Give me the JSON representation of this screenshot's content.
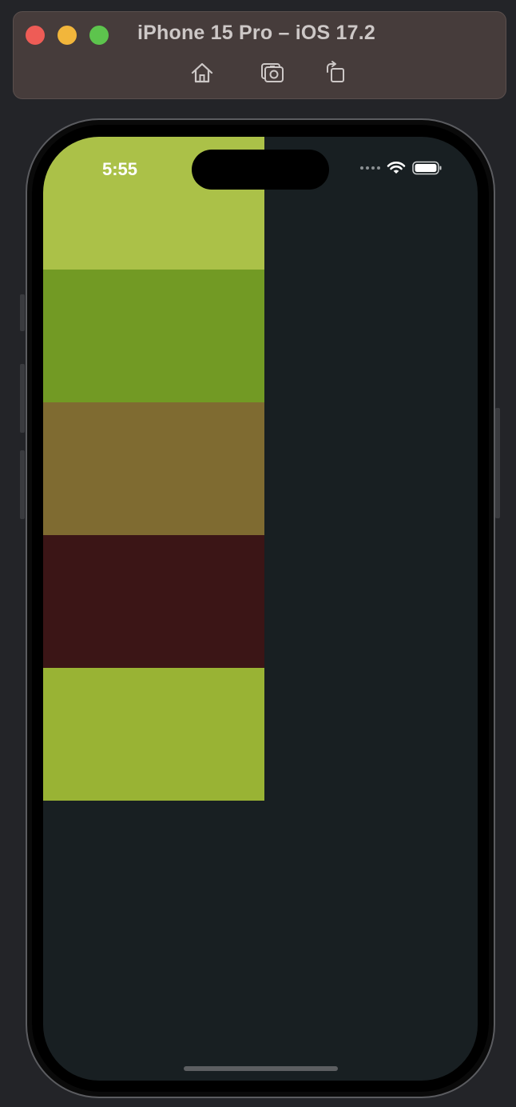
{
  "window": {
    "title": "iPhone 15 Pro – iOS 17.2",
    "toolbar": [
      {
        "icon": "home-icon",
        "label": "Home"
      },
      {
        "icon": "screenshot-icon",
        "label": "Screenshot"
      },
      {
        "icon": "rotate-icon",
        "label": "Rotate"
      }
    ]
  },
  "status_bar": {
    "time": "5:55"
  },
  "colors": {
    "screen_background": "#181f22",
    "swatches": [
      "#abc148",
      "#729a24",
      "#7f6b31",
      "#3b1516",
      "#99b334"
    ]
  }
}
